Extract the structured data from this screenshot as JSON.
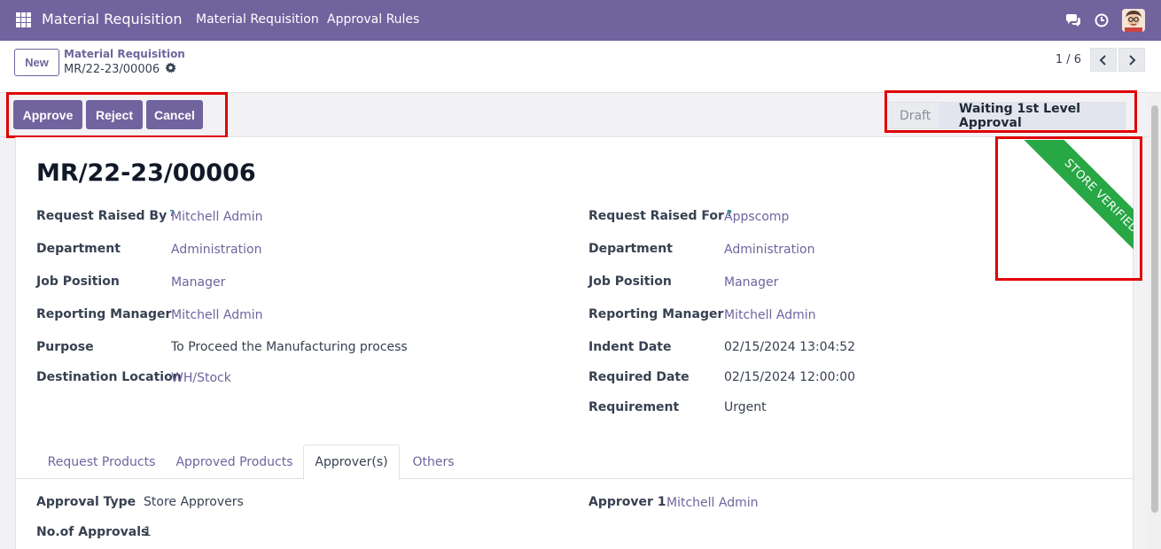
{
  "navbar": {
    "brand": "Material Requisition",
    "menu": [
      "Material Requisition",
      "Approval Rules"
    ]
  },
  "control_panel": {
    "new_label": "New",
    "breadcrumb_parent": "Material Requisition",
    "breadcrumb_current": "MR/22-23/00006",
    "pager": "1 / 6"
  },
  "actions": {
    "approve": "Approve",
    "reject": "Reject",
    "cancel": "Cancel"
  },
  "stages": {
    "draft": "Draft",
    "current": "Waiting 1st Level Approval"
  },
  "ribbon": "STORE VERIFIED",
  "form": {
    "title": "MR/22-23/00006",
    "left": [
      {
        "label": "Request Raised By",
        "help": "?",
        "value": "Mitchell Admin"
      },
      {
        "label": "Department",
        "value": "Administration"
      },
      {
        "label": "Job Position",
        "value": "Manager"
      },
      {
        "label": "Reporting Manager",
        "value": "Mitchell Admin"
      },
      {
        "label": "Purpose",
        "value": "To Proceed the Manufacturing process"
      },
      {
        "label": "Destination Location",
        "value": "WH/Stock"
      }
    ],
    "right": [
      {
        "label": "Request Raised For",
        "help": "?",
        "value": "Appscomp"
      },
      {
        "label": "Department",
        "value": "Administration"
      },
      {
        "label": "Job Position",
        "value": "Manager"
      },
      {
        "label": "Reporting Manager",
        "value": "Mitchell Admin"
      },
      {
        "label": "Indent Date",
        "value": "02/15/2024 13:04:52"
      },
      {
        "label": "Required Date",
        "value": "02/15/2024 12:00:00"
      },
      {
        "label": "Requirement",
        "value": "Urgent"
      }
    ]
  },
  "tabs": [
    "Request Products",
    "Approved Products",
    "Approver(s)",
    "Others"
  ],
  "approvers": {
    "approval_type_label": "Approval Type",
    "approval_type_value": "Store Approvers",
    "no_approvals_label": "No.of Approvals",
    "no_approvals_value": "1",
    "approver1_label": "Approver 1",
    "approver1_value": "Mitchell Admin"
  },
  "colors": {
    "brand": "#71639e",
    "ribbon": "#28a745",
    "highlight": "#e00000"
  }
}
